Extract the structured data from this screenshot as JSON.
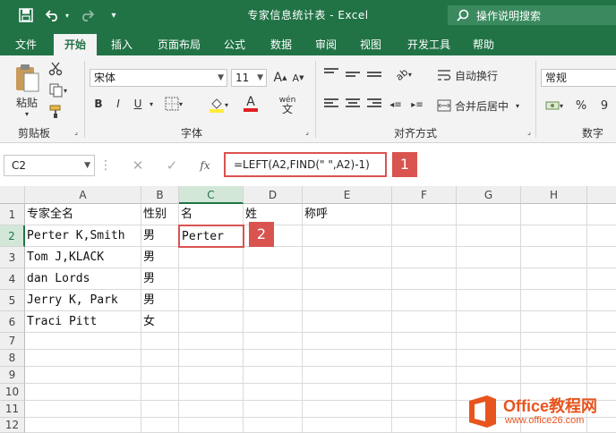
{
  "titlebar": {
    "title": "专家信息统计表  -  Excel",
    "search_label": "操作说明搜索"
  },
  "tabs": [
    "文件",
    "开始",
    "插入",
    "页面布局",
    "公式",
    "数据",
    "审阅",
    "视图",
    "开发工具",
    "帮助"
  ],
  "active_tab": "开始",
  "ribbon": {
    "paste_label": "粘贴",
    "clipboard_label": "剪贴板",
    "font_name": "宋体",
    "font_size": "11",
    "font_group_label": "字体",
    "bold": "B",
    "italic": "I",
    "underline": "U",
    "font_color_glyph": "A",
    "grow_glyph": "A",
    "shrink_glyph": "A",
    "wen_glyph": "wén",
    "wen_sub": "文",
    "wrap_label": "自动换行",
    "merge_label": "合并后居中",
    "align_group_label": "对齐方式",
    "number_format": "常规",
    "percent": "%",
    "comma": "9",
    "number_group_label": "数字"
  },
  "formula_bar": {
    "name_box": "C2",
    "fx": "fx",
    "formula": "=LEFT(A2,FIND(\" \",A2)-1)",
    "badge": "1"
  },
  "grid": {
    "columns": [
      "A",
      "B",
      "C",
      "D",
      "E",
      "F",
      "G",
      "H"
    ],
    "rows": [
      "1",
      "2",
      "3",
      "4",
      "5",
      "6",
      "7",
      "8",
      "9",
      "10",
      "11",
      "12"
    ],
    "cells": {
      "A1": "专家全名",
      "B1": "性别",
      "C1": "名",
      "D1": "姓",
      "E1": "称呼",
      "A2": "Perter K,Smith",
      "B2": "男",
      "C2": "Perter",
      "A3": "Tom J,KLACK",
      "B3": "男",
      "A4": "dan Lords",
      "B4": "男",
      "A5": "Jerry K, Park",
      "B5": "男",
      "A6": "Traci Pitt",
      "B6": "女"
    },
    "selected_cell": "C2",
    "badge": "2"
  },
  "watermark": {
    "brand": "Office教程网",
    "url": "www.office26.com"
  },
  "colors": {
    "excel_green": "#217346",
    "highlight_red": "#d9534f"
  }
}
